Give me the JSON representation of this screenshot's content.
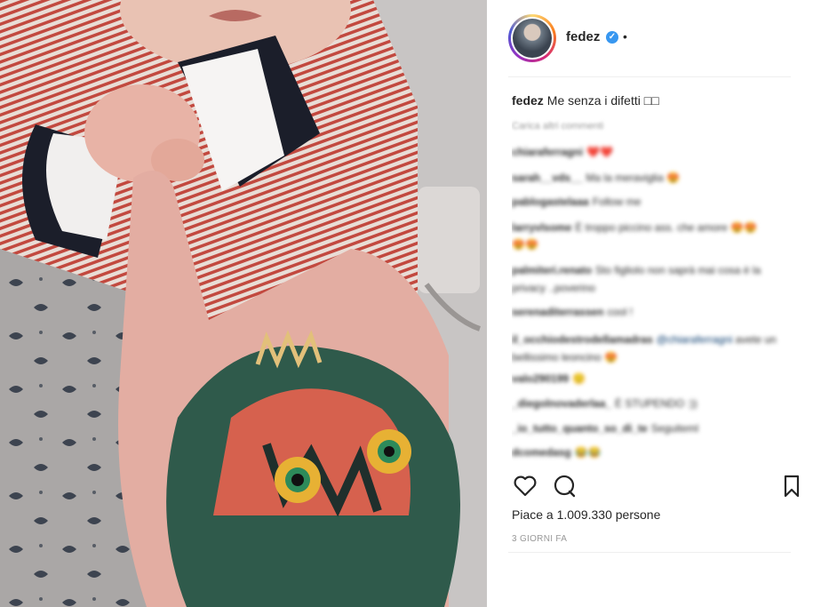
{
  "post": {
    "username": "fedez",
    "verified_mark": "✓",
    "header_dot": "•",
    "caption_user": "fedez",
    "caption_text": "Me senza i difetti",
    "caption_emoji": "□□",
    "load_more": "Carica altri commenti",
    "comments": [
      {
        "user": "chiaraferragni",
        "text": "❤️❤️"
      },
      {
        "user": "sarah__vds__",
        "text": "Ma la meraviglia 😍"
      },
      {
        "user": "pablogastelaaa",
        "text": "Follow me"
      },
      {
        "user": "larryvlsome",
        "text": "È troppo piccino ass. che amore 😍😍😍😍"
      },
      {
        "user": "",
        "text": ""
      },
      {
        "user": "palmiteri.renato",
        "text": "Sto figliolo non saprà mai cosa è la privacy ..poverino"
      },
      {
        "user": "",
        "text": ""
      },
      {
        "user": "serenaditerrassen",
        "text": "cool !"
      },
      {
        "user": "il_occhiodestrodellamadras",
        "text": "@chiaraferragni",
        "extra": "avete un bellissimo leoncino 😍"
      },
      {
        "user": "valo290199",
        "text": "😌"
      },
      {
        "user": "_diegolnovaderlaa_",
        "text": "È STUPENDO :))"
      },
      {
        "user": "_io_tutto_quanto_so_di_te",
        "text": "Seguiteml"
      },
      {
        "user": "dcomedasg",
        "text": "😂😂"
      }
    ],
    "likes_text": "Piace a 1.009.330 persone",
    "date_text": "3 GIORNI FA"
  },
  "icons": {
    "like": "heart-icon",
    "comment": "comment-icon",
    "save": "bookmark-icon",
    "verified": "verified-badge-icon"
  },
  "colors": {
    "verified_blue": "#3897f0",
    "text_primary": "#262626",
    "text_secondary": "#999999"
  }
}
